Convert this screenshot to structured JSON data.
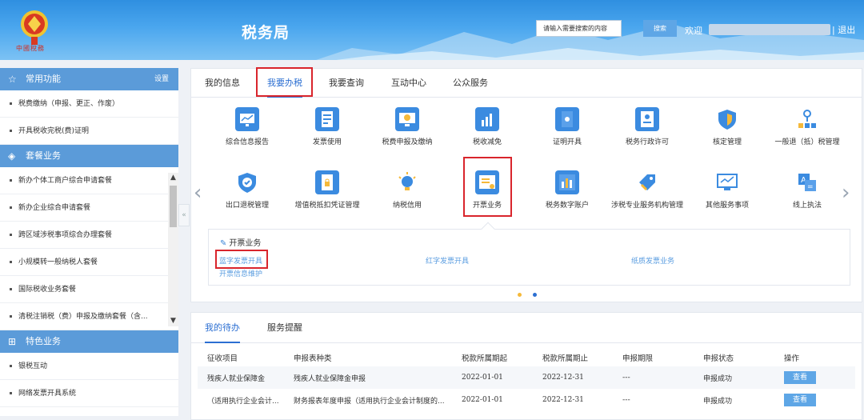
{
  "header": {
    "logo_text": "中國稅務",
    "brand": "税务局",
    "search_placeholder": "请输入需要搜索的内容",
    "search_button": "搜索",
    "welcome": "欢迎",
    "exit": "| 退出"
  },
  "sidebar": {
    "section_common": {
      "title": "常用功能",
      "settings": "设置"
    },
    "common_items": [
      "税费缴纳（申报、更正、作废）",
      "开具税收完税(费)证明"
    ],
    "section_package": {
      "title": "套餐业务"
    },
    "package_items": [
      "新办个体工商户综合申请套餐",
      "新办企业综合申请套餐",
      "跨区域涉税事项综合办理套餐",
      "小规模转一般纳税人套餐",
      "国际税收业务套餐",
      "清税注销税（费）申报及缴纳套餐（含..."
    ],
    "section_special": {
      "title": "特色业务"
    },
    "special_items": [
      "银税互动",
      "网络发票开具系统"
    ]
  },
  "tabs": [
    "我的信息",
    "我要办税",
    "我要查询",
    "互动中心",
    "公众服务"
  ],
  "active_tab": "我要办税",
  "services_row1": [
    "综合信息报告",
    "发票使用",
    "税费申报及缴纳",
    "税收减免",
    "证明开具",
    "税务行政许可",
    "核定管理",
    "一般退（抵）税管理"
  ],
  "services_row2": [
    "出口退税管理",
    "增值税抵扣凭证管理",
    "纳税信用",
    "开票业务",
    "税务数字账户",
    "涉税专业服务机构管理",
    "其他服务事项",
    "线上执法"
  ],
  "sub_panel": {
    "title": "开票业务",
    "links": [
      "蓝字发票开具",
      "红字发票开具",
      "纸质发票业务",
      "开票信息维护"
    ]
  },
  "bottom_tabs": [
    "我的待办",
    "服务提醒"
  ],
  "table": {
    "headers": [
      "征收项目",
      "申报表种类",
      "税款所属期起",
      "税款所属期止",
      "申报期限",
      "申报状态",
      "操作"
    ],
    "rows": [
      [
        "残疾人就业保障金",
        "残疾人就业保障金申报",
        "2022-01-01",
        "2022-12-31",
        "---",
        "申报成功",
        "查看"
      ],
      [
        "（适用执行企业会计...",
        "财务报表年度申报（适用执行企业会计制度的...",
        "2022-01-01",
        "2022-12-31",
        "---",
        "申报成功",
        "查看"
      ]
    ]
  },
  "colors": {
    "accent": "#2c6fd2",
    "sidebar_header": "#5b9bd9",
    "highlight": "#d9252c"
  }
}
